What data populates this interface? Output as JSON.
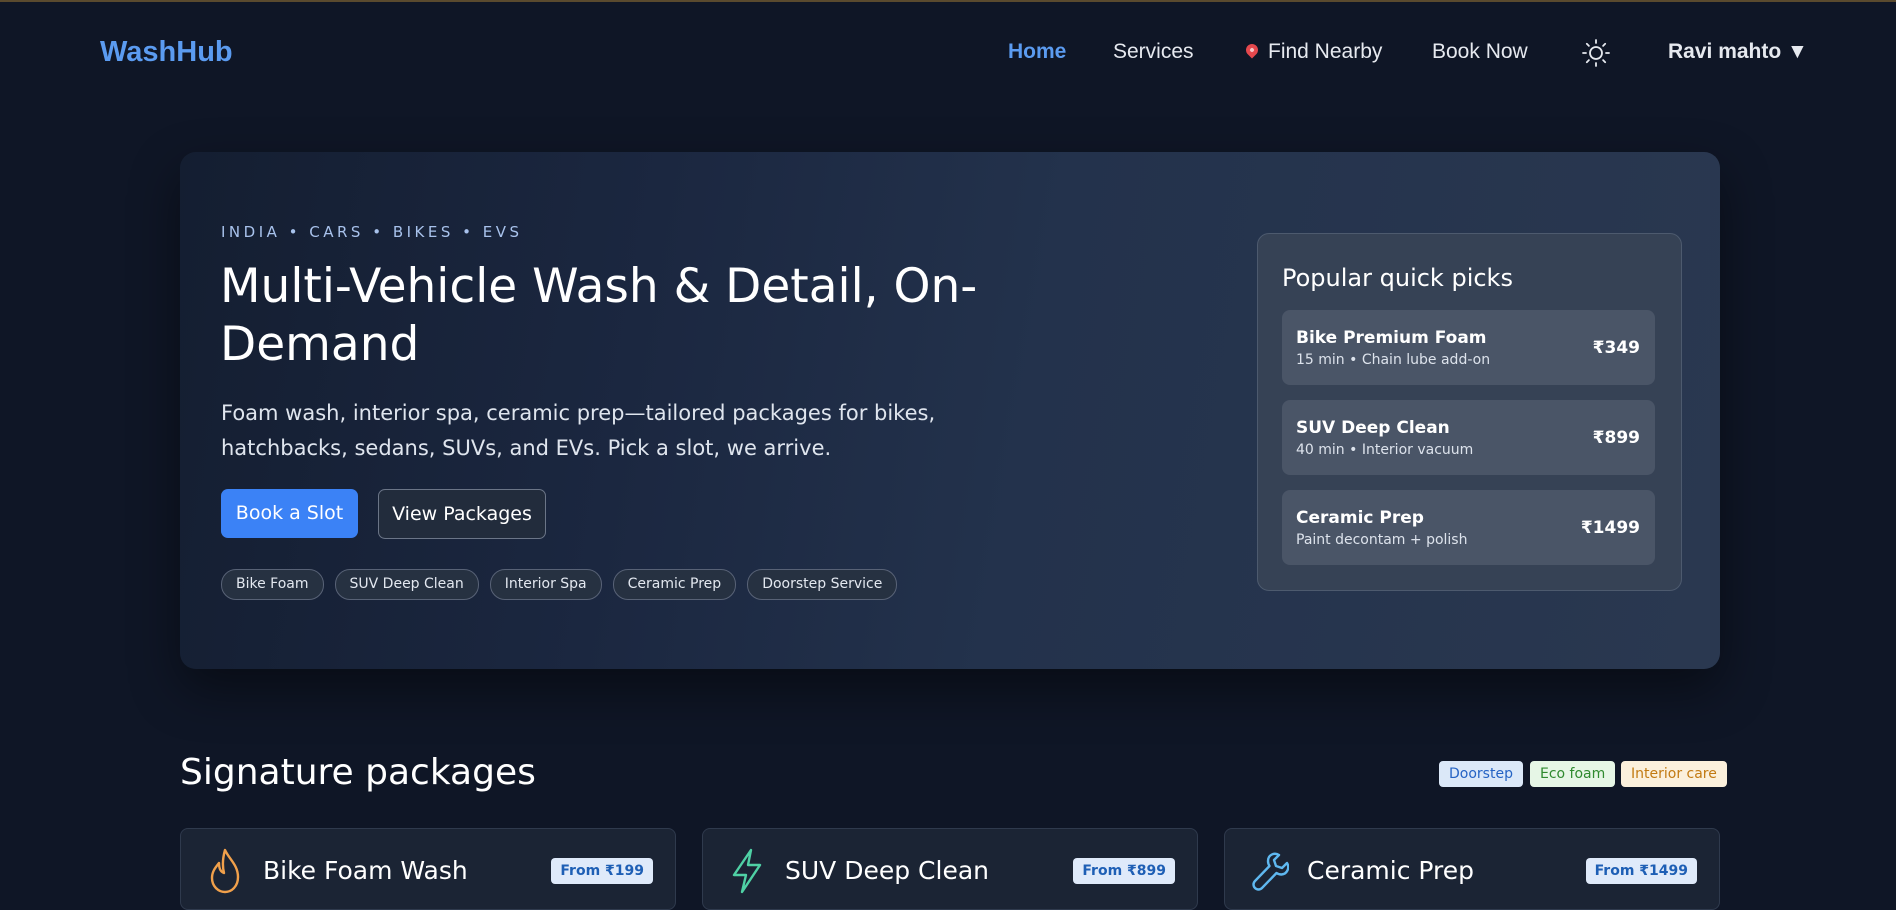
{
  "nav": {
    "logo": "WashHub",
    "links": [
      {
        "label": "Home",
        "active": true
      },
      {
        "label": "Services"
      },
      {
        "label": "Find Nearby",
        "icon": "map-pin-icon"
      },
      {
        "label": "Book Now"
      }
    ],
    "theme_icon": "sun-icon",
    "user_label": "Ravi mahto ▼"
  },
  "hero": {
    "eyebrow": "INDIA • CARS • BIKES • EVS",
    "title": "Multi-Vehicle Wash & Detail, On-Demand",
    "subtitle": "Foam wash, interior spa, ceramic prep—tailored packages for bikes, hatchbacks, sedans, SUVs, and EVs. Pick a slot, we arrive.",
    "primary_button": "Book a Slot",
    "secondary_button": "View Packages",
    "chips": [
      "Bike Foam",
      "SUV Deep Clean",
      "Interior Spa",
      "Ceramic Prep",
      "Doorstep Service"
    ]
  },
  "quick_picks": {
    "title": "Popular quick picks",
    "items": [
      {
        "name": "Bike Premium Foam",
        "meta": "15 min • Chain lube add-on",
        "price": "₹349"
      },
      {
        "name": "SUV Deep Clean",
        "meta": "40 min • Interior vacuum",
        "price": "₹899"
      },
      {
        "name": "Ceramic Prep",
        "meta": "Paint decontam + polish",
        "price": "₹1499"
      }
    ]
  },
  "packages": {
    "title": "Signature packages",
    "tags": [
      {
        "label": "Doorstep",
        "bg": "#dbe8f8",
        "color": "#2563c4"
      },
      {
        "label": "Eco foam",
        "bg": "#e6f6e6",
        "color": "#2f8a2f"
      },
      {
        "label": "Interior care",
        "bg": "#fbf0dc",
        "color": "#c27a12"
      }
    ],
    "cards": [
      {
        "title": "Bike Foam Wash",
        "badge": "From ₹199",
        "icon": "flame-icon",
        "icon_color": "#f0a04b"
      },
      {
        "title": "SUV Deep Clean",
        "badge": "From ₹899",
        "icon": "lightning-icon",
        "icon_color": "#4fd1a5"
      },
      {
        "title": "Ceramic Prep",
        "badge": "From ₹1499",
        "icon": "wrench-icon",
        "icon_color": "#5fb8f0"
      }
    ]
  }
}
